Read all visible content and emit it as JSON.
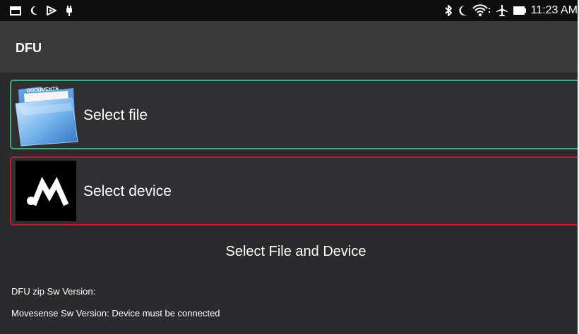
{
  "status_bar": {
    "time": "11:23 AM",
    "left_icons": [
      "gallery-icon",
      "moon-icon",
      "media-icon",
      "notification-icon"
    ],
    "right_icons": [
      "bluetooth-icon",
      "moon-icon",
      "wifi-icon",
      "airplane-icon",
      "battery-icon"
    ]
  },
  "app_bar": {
    "title": "DFU"
  },
  "cards": {
    "file": {
      "label": "Select file",
      "icon": "documents-folder-icon",
      "folder_text": "DOCUMENTS",
      "border_color": "#45a77a"
    },
    "device": {
      "label": "Select device",
      "icon": "movesense-logo-icon",
      "border_color": "#b0232b"
    }
  },
  "main_status": "Select File and Device",
  "info": {
    "dfu_zip_version": "DFU zip Sw Version:",
    "movesense_version": "Movesense Sw Version: Device must be connected"
  },
  "colors": {
    "background": "#2b2b2d",
    "app_bar": "#3a3a3b",
    "status_bar": "#0e0e0f"
  }
}
